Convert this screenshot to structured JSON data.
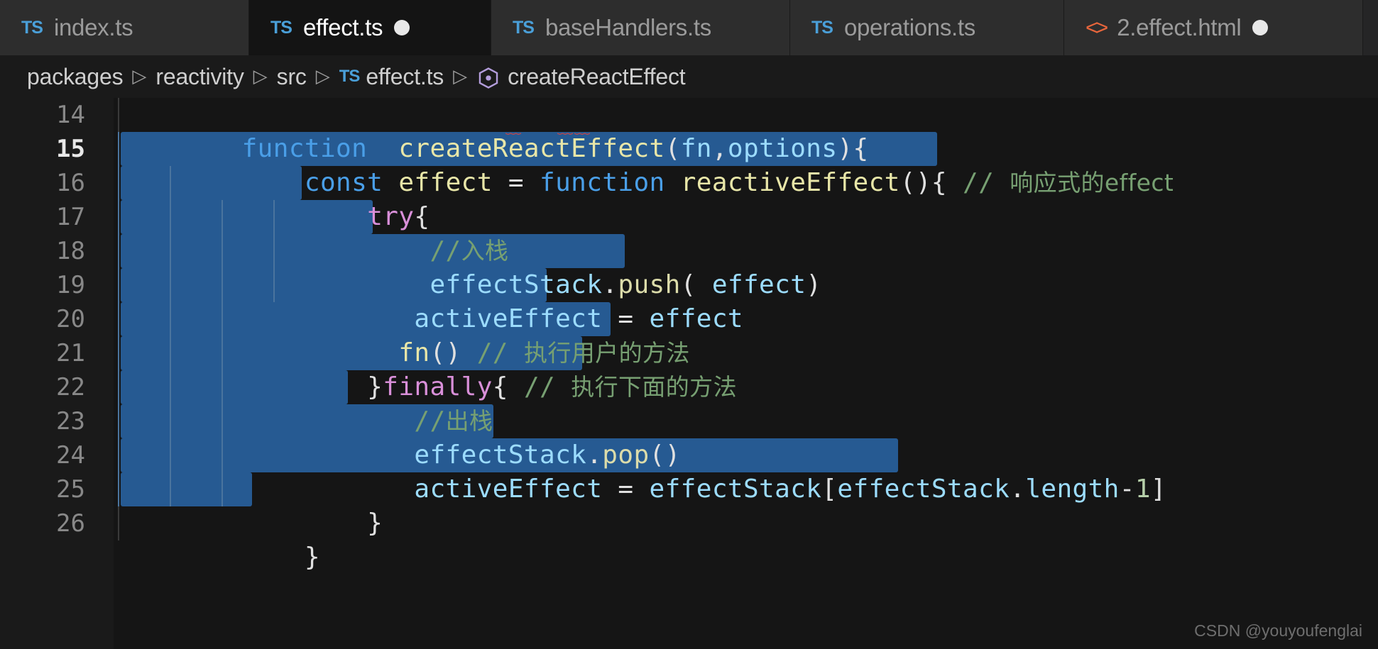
{
  "window": {
    "theme_bg": "#151515",
    "selection_color": "#265a92",
    "accent": "#4a9fe8"
  },
  "tabs": [
    {
      "label": "index.ts",
      "icon": "ts-file-icon",
      "icon_text": "TS",
      "active": false,
      "dirty": false
    },
    {
      "label": "effect.ts",
      "icon": "ts-file-icon",
      "icon_text": "TS",
      "active": true,
      "dirty": true
    },
    {
      "label": "baseHandlers.ts",
      "icon": "ts-file-icon",
      "icon_text": "TS",
      "active": false,
      "dirty": false
    },
    {
      "label": "operations.ts",
      "icon": "ts-file-icon",
      "icon_text": "TS",
      "active": false,
      "dirty": false
    },
    {
      "label": "2.effect.html",
      "icon": "html-file-icon",
      "icon_text": "<>",
      "active": false,
      "dirty": true
    }
  ],
  "breadcrumb": {
    "separator": "▷",
    "items": [
      {
        "label": "packages",
        "icon": ""
      },
      {
        "label": "reactivity",
        "icon": ""
      },
      {
        "label": "src",
        "icon": ""
      },
      {
        "label": "effect.ts",
        "icon": "ts-file-icon"
      },
      {
        "label": "createReactEffect",
        "icon": "symbol-method-icon"
      }
    ]
  },
  "editor": {
    "first_line": 14,
    "current_line": 15,
    "watermark": "CSDN @youyoufenglai",
    "lines": [
      {
        "n": "14"
      },
      {
        "n": "15"
      },
      {
        "n": "16"
      },
      {
        "n": "17"
      },
      {
        "n": "18"
      },
      {
        "n": "19"
      },
      {
        "n": "20"
      },
      {
        "n": "21"
      },
      {
        "n": "22"
      },
      {
        "n": "23"
      },
      {
        "n": "24"
      },
      {
        "n": "25"
      },
      {
        "n": "26"
      }
    ],
    "code": {
      "l14": "function  createReactEffect(fn,options){",
      "l15": "    const effect = function reactiveEffect(){ // 响应式的effect",
      "l16": "        try{",
      "l17": "            //入栈",
      "l18": "            effectStack.push( effect)",
      "l19": "           activeEffect = effect",
      "l20": "          fn() // 执行用户的方法",
      "l21": "        }finally{ // 执行下面的方法",
      "l22": "           //出栈",
      "l23": "           effectStack.pop()",
      "l24": "           activeEffect = effectStack[effectStack.length-1]",
      "l25": "        }",
      "l26": "    }"
    },
    "tokens": {
      "function_kw": "function",
      "const_kw": "const",
      "try_kw": "try",
      "finally_kw": "finally",
      "fn_name_outer": "createReactEffect",
      "fn_name_inner": "reactiveEffect",
      "param_fn": "fn",
      "param_options": "options",
      "var_effect": "effect",
      "var_effectStack": "effectStack",
      "var_activeEffect": "activeEffect",
      "method_push": "push",
      "method_pop": "pop",
      "prop_length": "length",
      "comment_l15": "// 响应式的effect",
      "comment_l17": "//入栈",
      "comment_l20": "// 执行用户的方法",
      "comment_l21": "// 执行下面的方法",
      "comment_l22": "//出栈"
    }
  }
}
